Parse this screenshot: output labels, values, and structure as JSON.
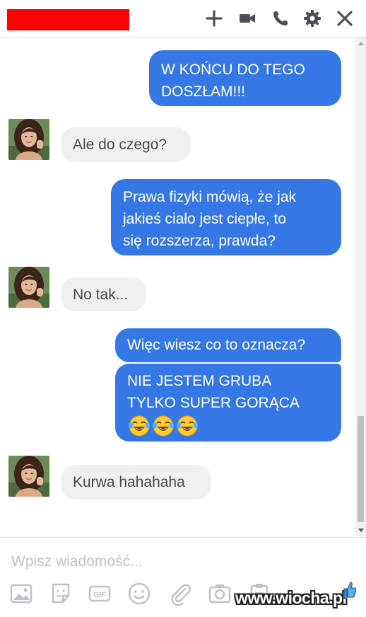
{
  "header": {
    "icons": [
      "plus-icon",
      "video-camera-icon",
      "phone-icon",
      "gear-icon",
      "close-icon"
    ],
    "colors": {
      "redaction": "#ff0000",
      "icon": "#4b4f56"
    }
  },
  "messages": [
    {
      "sender": "me",
      "text": "W KOŃCU DO TEGO\nDOSZŁAM!!!"
    },
    {
      "sender": "friend",
      "text": "Ale do czego?"
    },
    {
      "sender": "me",
      "text": "Prawa fizyki mówią, że jak\njakieś ciało jest ciepłe, to\nsię rozszerza, prawda?"
    },
    {
      "sender": "friend",
      "text": "No tak..."
    },
    {
      "sender": "me",
      "text": "Więc wiesz co to oznacza?"
    },
    {
      "sender": "me",
      "text": "NIE JESTEM GRUBA\nTYLKO SUPER GORĄCA",
      "emoji": [
        "face-with-tears-of-joy",
        "face-with-tears-of-joy",
        "face-with-tears-of-joy"
      ]
    },
    {
      "sender": "friend",
      "text": "Kurwa hahahaha"
    }
  ],
  "colors": {
    "outgoing_bubble": "#3578e5",
    "incoming_bubble": "#f1f0f0",
    "incoming_text": "#444950"
  },
  "composer": {
    "placeholder": "Wpisz wiadomość...",
    "tools": [
      "image-icon",
      "sticker-icon",
      "gif-icon",
      "emoji-icon",
      "paperclip-icon",
      "camera-icon",
      "clipboard-icon"
    ],
    "gif_label": "GIF"
  },
  "watermark": {
    "text": "www.wiocha.pl"
  }
}
